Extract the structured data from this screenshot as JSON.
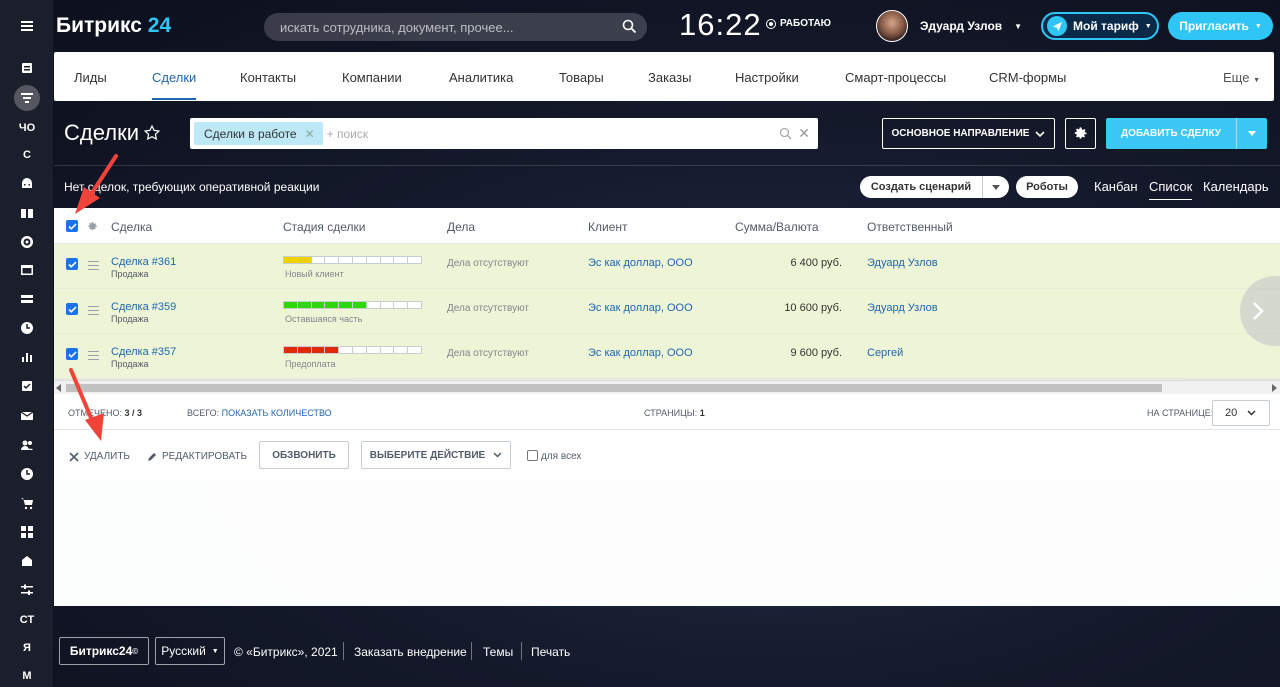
{
  "header": {
    "logo_text": "Битрикс",
    "logo_num": "24",
    "search_placeholder": "искать сотрудника, документ, прочее...",
    "clock": "16:22",
    "work_status": "РАБОТАЮ",
    "user_name": "Эдуард Узлов",
    "tariff_label": "Мой тариф",
    "invite_label": "Пригласить"
  },
  "left_rail": {
    "items": [
      {
        "icon": "feed-icon"
      },
      {
        "icon": "funnel-icon"
      },
      {
        "label": "ЧО"
      },
      {
        "label": "С"
      },
      {
        "icon": "android-icon"
      },
      {
        "icon": "book-icon"
      },
      {
        "icon": "target-icon"
      },
      {
        "icon": "window-icon"
      },
      {
        "icon": "layers-icon"
      },
      {
        "icon": "clock-dollar-icon"
      },
      {
        "icon": "bar-chart-icon"
      },
      {
        "icon": "checklist-icon"
      },
      {
        "icon": "mail-icon"
      },
      {
        "icon": "people-icon"
      },
      {
        "icon": "clock-icon"
      },
      {
        "icon": "cart-icon"
      },
      {
        "icon": "apps-icon"
      },
      {
        "icon": "sites-icon"
      },
      {
        "icon": "sliders-icon"
      },
      {
        "label": "СТ"
      },
      {
        "label": "Я"
      },
      {
        "label": "М"
      }
    ]
  },
  "crm_nav": {
    "tabs": [
      "Лиды",
      "Сделки",
      "Контакты",
      "Компании",
      "Аналитика",
      "Товары",
      "Заказы",
      "Настройки",
      "Смарт-процессы",
      "CRM-формы"
    ],
    "active_tab": "Сделки",
    "more": "Еще"
  },
  "toolbar": {
    "title": "Сделки",
    "filter_chip": "Сделки в работе",
    "filter_placeholder": "+ поиск",
    "direction": "ОСНОВНОЕ НАПРАВЛЕНИЕ",
    "add_deal": "ДОБАВИТЬ СДЕЛКУ"
  },
  "info_bar": {
    "message": "Нет сделок, требующих оперативной реакции",
    "scenario": "Создать сценарий",
    "robots": "Роботы",
    "views": [
      "Канбан",
      "Список",
      "Календарь"
    ],
    "active_view": "Список"
  },
  "grid": {
    "columns": [
      "Сделка",
      "Стадия сделки",
      "Дела",
      "Клиент",
      "Сумма/Валюта",
      "Ответственный"
    ],
    "rows": [
      {
        "title": "Сделка #361",
        "category": "Продажа",
        "stage": "Новый клиент",
        "stage_color": "#f0d100",
        "stage_progress": 2,
        "tasks": "Дела отсутствуют",
        "client": "Эс как доллар, ООО",
        "amount": "6 400 руб.",
        "owner": "Эдуард Узлов",
        "checked": true
      },
      {
        "title": "Сделка #359",
        "category": "Продажа",
        "stage": "Оставшаяся часть",
        "stage_color": "#2fd80a",
        "stage_progress": 6,
        "tasks": "Дела отсутствуют",
        "client": "Эс как доллар, ООО",
        "amount": "10 600 руб.",
        "owner": "Эдуард Узлов",
        "checked": true
      },
      {
        "title": "Сделка #357",
        "category": "Продажа",
        "stage": "Предоплата",
        "stage_color": "#e02a0a",
        "stage_progress": 4,
        "tasks": "Дела отсутствуют",
        "client": "Эс как доллар, ООО",
        "amount": "9 600 руб.",
        "owner": "Сергей",
        "checked": true
      }
    ],
    "stage_segments": 10
  },
  "grid_footer": {
    "checked_label": "Отмечено:",
    "checked_value": "3 / 3",
    "total_label": "Всего:",
    "total_link": "Показать количество",
    "pages_label": "Страницы:",
    "pages_value": "1",
    "per_page_label": "На странице:",
    "per_page_value": "20"
  },
  "actions": {
    "delete": "Удалить",
    "edit": "Редактировать",
    "call": "ОБЗВОНИТЬ",
    "choose_action": "ВЫБЕРИТЕ ДЕЙСТВИЕ",
    "for_all": "для всех"
  },
  "footer": {
    "brand": "Битрикс24",
    "language": "Русский",
    "copyright": "© «Битрикс», 2021",
    "links": [
      "Заказать внедрение",
      "Темы",
      "Печать"
    ]
  },
  "colors": {
    "accent": "#2fc6f6",
    "link": "#2067b0",
    "row_selected": "#eef5d6",
    "annotation": "#f0433a"
  }
}
